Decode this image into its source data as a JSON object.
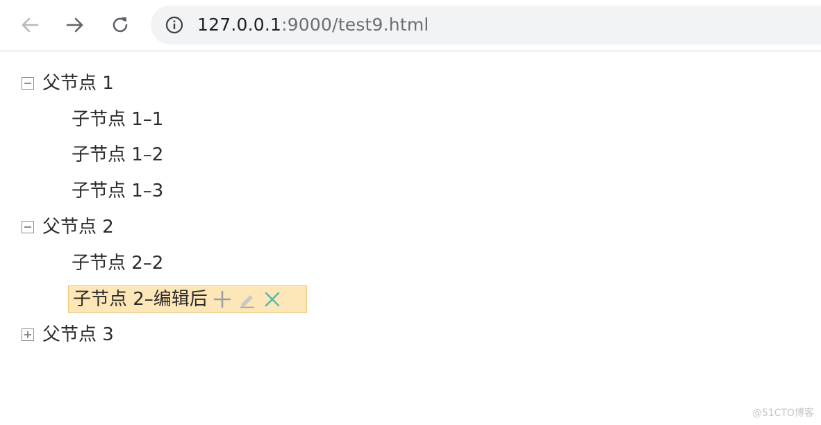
{
  "browser": {
    "url_host": "127.0.0.1",
    "url_rest": ":9000/test9.html",
    "icons": {
      "back": "back-arrow-icon",
      "forward": "forward-arrow-icon",
      "reload": "reload-icon",
      "info": "info-icon"
    }
  },
  "tree": {
    "nodes": [
      {
        "label": "父节点 1",
        "kind": "parent",
        "state": "expanded"
      },
      {
        "label": "子节点 1–1",
        "kind": "child"
      },
      {
        "label": "子节点 1–2",
        "kind": "child"
      },
      {
        "label": "子节点 1–3",
        "kind": "child"
      },
      {
        "label": "父节点 2",
        "kind": "parent",
        "state": "expanded"
      },
      {
        "label": "子节点 2–2",
        "kind": "child"
      },
      {
        "label": "子节点 2–编辑后",
        "kind": "child",
        "state": "selected-editing",
        "actions": [
          "add-icon",
          "edit-icon",
          "delete-icon"
        ]
      },
      {
        "label": "父节点 3",
        "kind": "parent",
        "state": "collapsed"
      }
    ]
  },
  "colors": {
    "selected_bg": "#fde7b8",
    "selected_border": "#f0c77a",
    "add_icon": "#9aa0a6",
    "delete_icon": "#5ab8a8"
  },
  "watermark": "@51CTO博客"
}
